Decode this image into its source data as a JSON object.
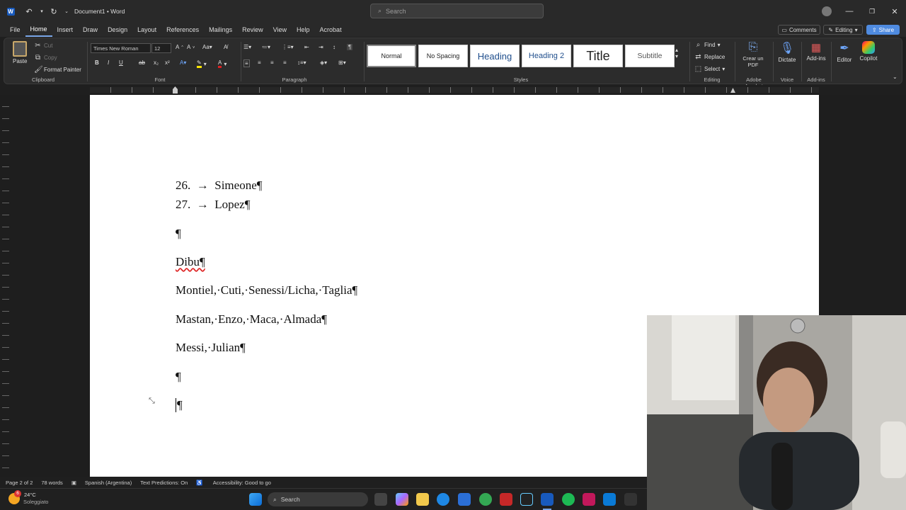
{
  "titlebar": {
    "title": "Document1 • Word",
    "search_placeholder": "Search"
  },
  "menu": {
    "tabs": [
      "File",
      "Home",
      "Insert",
      "Draw",
      "Design",
      "Layout",
      "References",
      "Mailings",
      "Review",
      "View",
      "Help",
      "Acrobat"
    ],
    "comments_label": "Comments",
    "editing_label": "Editing",
    "share_label": "Share"
  },
  "ribbon": {
    "clipboard": {
      "paste": "Paste",
      "cut": "Cut",
      "copy": "Copy",
      "format_painter": "Format Painter",
      "label": "Clipboard"
    },
    "font": {
      "family": "Times New Roman",
      "size": "12",
      "label": "Font"
    },
    "paragraph": {
      "label": "Paragraph"
    },
    "styles": {
      "items": [
        "Normal",
        "No Spacing",
        "Heading",
        "Heading 2",
        "Title",
        "Subtitle"
      ],
      "label": "Styles"
    },
    "editing": {
      "find": "Find",
      "replace": "Replace",
      "select": "Select",
      "label": "Editing"
    },
    "acrobat": {
      "btn": "Crear un PDF",
      "label": "Adobe Acrobat"
    },
    "voice": {
      "btn": "Dictate",
      "label": "Voice"
    },
    "addins": {
      "btn": "Add-ins",
      "label": "Add-ins"
    },
    "editor": {
      "btn": "Editor"
    },
    "copilot": {
      "btn": "Copilot"
    }
  },
  "document": {
    "lines": [
      "26.  →  Simeone¶",
      "27.  →  Lopez¶",
      "¶",
      "Dibu¶",
      "Montiel,·Cuti,·Senessi/Licha,·Taglia¶",
      "Mastan,·Enzo,·Maca,·Almada¶",
      "Messi,·Julian¶",
      "¶",
      "¶"
    ]
  },
  "status": {
    "page": "Page 2 of 2",
    "words": "78 words",
    "language": "Spanish (Argentina)",
    "predictions": "Text Predictions: On",
    "accessibility": "Accessibility: Good to go"
  },
  "taskbar": {
    "weather_temp": "24°C",
    "weather_desc": "Soleggiato",
    "weather_badge": "6",
    "search_label": "Search"
  },
  "colors": {
    "accent": "#7aa7e8",
    "word_blue": "#185abd",
    "page": "#ffffff",
    "chrome": "#292929"
  }
}
